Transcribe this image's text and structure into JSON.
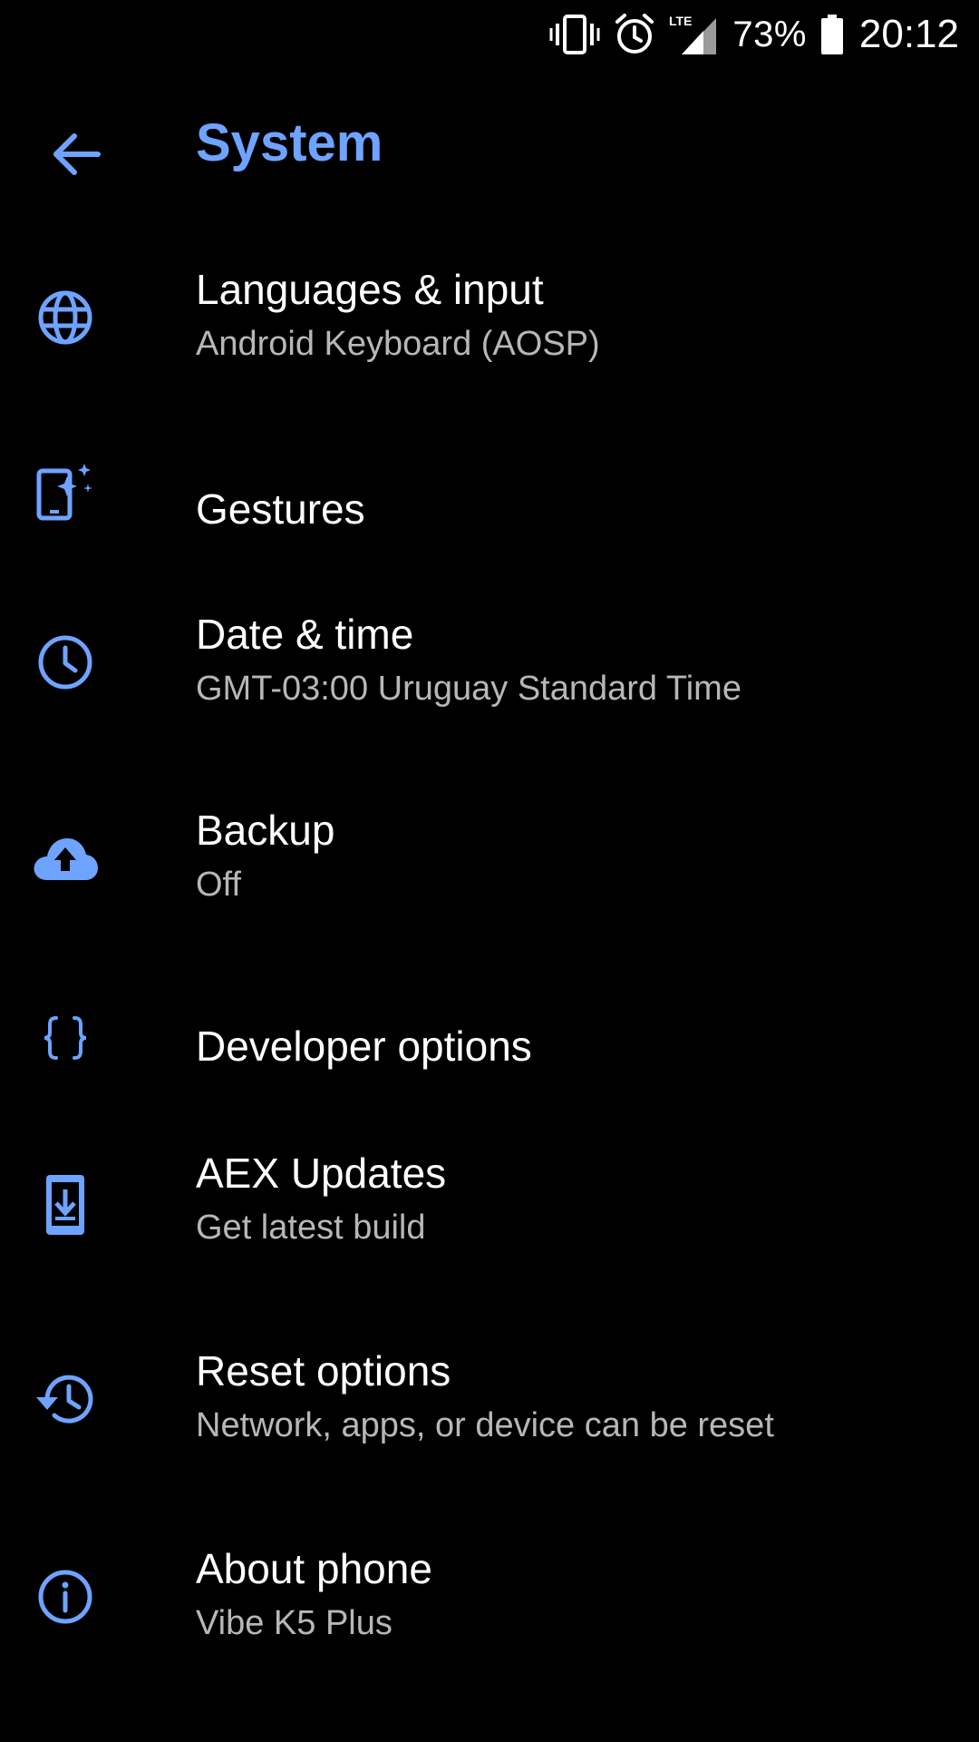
{
  "status_bar": {
    "battery_percent": "73%",
    "time": "20:12",
    "network": "LTE"
  },
  "app_bar": {
    "title": "System"
  },
  "colors": {
    "accent": "#6ea3ff",
    "background": "#000000",
    "title_text": "#ffffff",
    "subtitle_text": "#b7b7b7"
  },
  "settings": [
    {
      "icon": "globe-icon",
      "title": "Languages & input",
      "subtitle": "Android Keyboard (AOSP)"
    },
    {
      "icon": "gestures-icon",
      "title": "Gestures",
      "subtitle": ""
    },
    {
      "icon": "clock-icon",
      "title": "Date & time",
      "subtitle": "GMT-03:00 Uruguay Standard Time"
    },
    {
      "icon": "cloud-upload-icon",
      "title": "Backup",
      "subtitle": "Off"
    },
    {
      "icon": "braces-icon",
      "title": "Developer options",
      "subtitle": ""
    },
    {
      "icon": "system-update-icon",
      "title": "AEX Updates",
      "subtitle": "Get latest build"
    },
    {
      "icon": "restore-icon",
      "title": "Reset options",
      "subtitle": "Network, apps, or device can be reset"
    },
    {
      "icon": "info-icon",
      "title": "About phone",
      "subtitle": "Vibe K5 Plus"
    }
  ]
}
